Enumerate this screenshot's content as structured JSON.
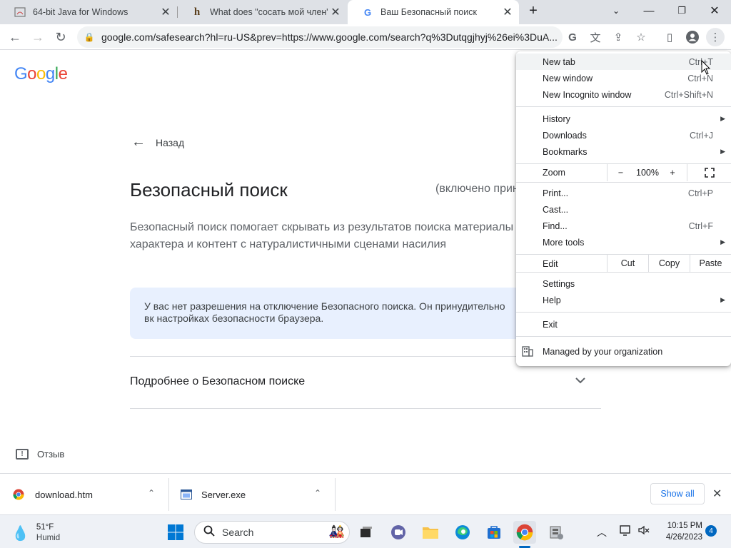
{
  "tabs": [
    {
      "title": "64-bit Java for Windows",
      "icon": "java-icon"
    },
    {
      "title": "What does \"сосать мой член\" (s",
      "icon": "h-icon"
    },
    {
      "title": "Ваш Безопасный поиск",
      "icon": "google-icon"
    }
  ],
  "toolbar": {
    "url": "google.com/safesearch?hl=ru-US&prev=https://www.google.com/search?q%3Dutqgjhyj%26ei%3DuA..."
  },
  "page": {
    "logo": "Google",
    "back_label": "Назад",
    "title": "Безопасный поиск",
    "status": "(включено прин",
    "description": "Безопасный поиск помогает скрывать из результатов поиска материалы характера и контент с натуралистичными сценами насилия",
    "notice": "У вас нет разрешения на отключение Безопасного поиска. Он принудительно вк настройках безопасности браузера.",
    "more_label": "Подробнее о Безопасном поиске",
    "feedback_label": "Отзыв"
  },
  "menu": {
    "new_tab": {
      "label": "New tab",
      "shortcut": "Ctrl+T"
    },
    "new_window": {
      "label": "New window",
      "shortcut": "Ctrl+N"
    },
    "incognito": {
      "label": "New Incognito window",
      "shortcut": "Ctrl+Shift+N"
    },
    "history": {
      "label": "History"
    },
    "downloads": {
      "label": "Downloads",
      "shortcut": "Ctrl+J"
    },
    "bookmarks": {
      "label": "Bookmarks"
    },
    "zoom": {
      "label": "Zoom",
      "minus": "−",
      "value": "100%",
      "plus": "+"
    },
    "print": {
      "label": "Print...",
      "shortcut": "Ctrl+P"
    },
    "cast": {
      "label": "Cast..."
    },
    "find": {
      "label": "Find...",
      "shortcut": "Ctrl+F"
    },
    "more_tools": {
      "label": "More tools"
    },
    "edit": {
      "label": "Edit",
      "cut": "Cut",
      "copy": "Copy",
      "paste": "Paste"
    },
    "settings": {
      "label": "Settings"
    },
    "help": {
      "label": "Help"
    },
    "exit": {
      "label": "Exit"
    },
    "managed": {
      "label": "Managed by your organization"
    }
  },
  "downloads": {
    "items": [
      {
        "name": "download.htm",
        "icon": "chrome-file-icon"
      },
      {
        "name": "Server.exe",
        "icon": "exe-file-icon"
      }
    ],
    "show_all": "Show all"
  },
  "taskbar": {
    "weather_temp": "51°F",
    "weather_desc": "Humid",
    "search_label": "Search",
    "time": "10:15 PM",
    "date": "4/26/2023",
    "notification_count": "4"
  },
  "colors": {
    "accent": "#1a73e8",
    "notice_bg": "#e8f0fe",
    "tabstrip_bg": "#dee1e6"
  }
}
